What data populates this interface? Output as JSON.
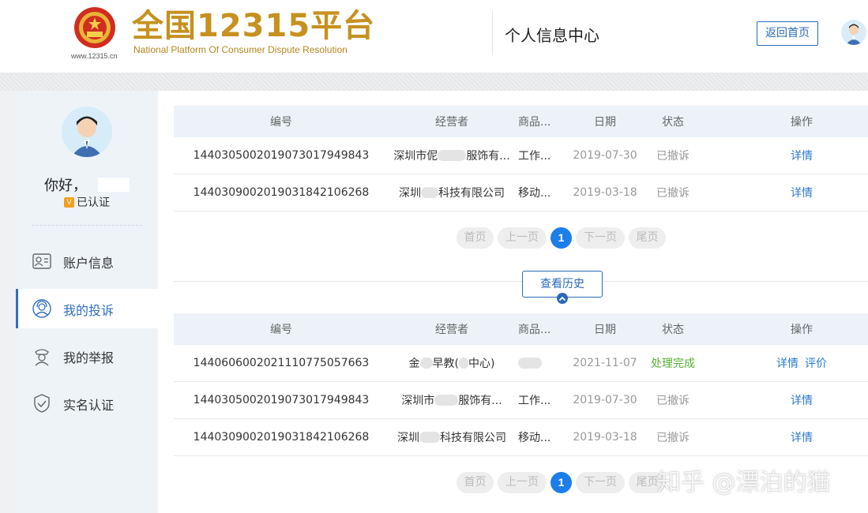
{
  "header": {
    "url": "www.12315.cn",
    "brand_title": "全国12315平台",
    "brand_subtitle": "National Platform Of Consumer Dispute Resolution",
    "page_title": "个人信息中心",
    "back_home_label": "返回首页"
  },
  "sidebar": {
    "greeting": "你好，",
    "verified_badge": "V",
    "verified_label": "已认证",
    "items": [
      {
        "label": "账户信息",
        "icon": "id-card-icon"
      },
      {
        "label": "我的投诉",
        "icon": "agent-icon"
      },
      {
        "label": "我的举报",
        "icon": "officer-icon"
      },
      {
        "label": "实名认证",
        "icon": "shield-check-icon"
      }
    ]
  },
  "table_headers": {
    "no": "编号",
    "operator": "经营者",
    "goods": "商品...",
    "date": "日期",
    "status": "状态",
    "action": "操作"
  },
  "complaints": [
    {
      "no": "1440305002019073017949843",
      "operator": "深圳市伲",
      "operator_tail": "服饰有...",
      "goods": "工作...",
      "date": "2019-07-30",
      "status": "已撤诉",
      "action": "详情"
    },
    {
      "no": "1440309002019031842106268",
      "operator": "深圳",
      "operator_tail": "科技有限公司",
      "goods": "移动...",
      "date": "2019-03-18",
      "status": "已撤诉",
      "action": "详情"
    }
  ],
  "history_button": "查看历史",
  "history": [
    {
      "no": "1440606002021110775057663",
      "operator": "金",
      "operator_tail": "早教(",
      "operator_end": "中心)",
      "goods": "",
      "date": "2021-11-07",
      "status": "处理完成",
      "action": "详情",
      "action2": "评价"
    },
    {
      "no": "1440305002019073017949843",
      "operator": "深圳市",
      "operator_tail": "服饰有...",
      "goods": "工作...",
      "date": "2019-07-30",
      "status": "已撤诉",
      "action": "详情"
    },
    {
      "no": "1440309002019031842106268",
      "operator": "深圳",
      "operator_tail": "科技有限公司",
      "goods": "移动...",
      "date": "2019-03-18",
      "status": "已撤诉",
      "action": "详情"
    }
  ],
  "pager": {
    "first": "首页",
    "prev": "上一页",
    "current": "1",
    "next": "下一页",
    "last": "尾页"
  },
  "watermark": "知乎 @漂泊的猫",
  "colors": {
    "brand_gold": "#c6911f",
    "link_blue": "#2a78cf",
    "active_blue": "#2e6fc0",
    "pager_current": "#1c7ee8",
    "status_done": "#55b030"
  }
}
